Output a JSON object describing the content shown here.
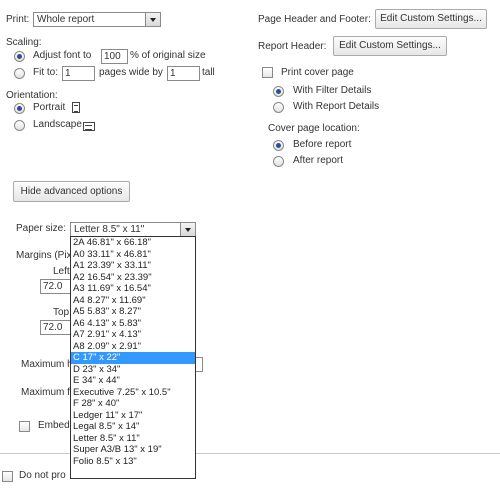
{
  "print": {
    "label": "Print:",
    "value": "Whole report"
  },
  "header_footer": {
    "label": "Page Header and Footer:",
    "button": "Edit Custom Settings..."
  },
  "report_header": {
    "label": "Report Header:",
    "button": "Edit Custom Settings..."
  },
  "scaling": {
    "label": "Scaling:",
    "adjust_label": "Adjust font to",
    "adjust_value": "100",
    "adjust_suffix": "% of original size",
    "fit_label": "Fit to:",
    "fit_wide": "1",
    "fit_mid": "pages wide by",
    "fit_tall": "1",
    "fit_suffix": "tall"
  },
  "cover": {
    "print_label": "Print cover page",
    "with_filter": "With Filter Details",
    "with_report": "With Report Details",
    "location_label": "Cover page location:",
    "before": "Before report",
    "after": "After report"
  },
  "orientation": {
    "label": "Orientation:",
    "portrait": "Portrait",
    "landscape": "Landscape"
  },
  "advanced_button": "Hide advanced options",
  "paper": {
    "label": "Paper size:",
    "value": "Letter 8.5\" x 11\"",
    "options": [
      "2A 46.81\" x 66.18\"",
      "A0 33.11\" x 46.81\"",
      "A1 23.39\" x 33.11\"",
      "A2 16.54\" x 23.39\"",
      "A3 11.69\" x 16.54\"",
      "A4 8.27\" x 11.69\"",
      "A5 5.83\" x 8.27\"",
      "A6 4.13\" x 5.83\"",
      "A7 2.91\" x 4.13\"",
      "A8 2.09\" x 2.91\"",
      "C 17\" x 22\"",
      "D 23\" x 34\"",
      "E 34\" x 44\"",
      "Executive 7.25\" x 10.5\"",
      "F 28\" x 40\"",
      "Ledger 11\" x 17\"",
      "Legal 8.5\" x 14\"",
      "Letter 8.5\" x 11\"",
      "Super A3/B 13\" x 19\"",
      "Folio 8.5\" x 13\""
    ],
    "selected": "C 17\" x 22\""
  },
  "margins": {
    "label": "Margins (Pix",
    "left_label": "Left",
    "left_value": "72.0",
    "top_label": "Top",
    "top_value": "72.0"
  },
  "maximum_h_label": "Maximum h",
  "maximum_f_label": "Maximum f",
  "embed_label": "Embed",
  "do_not_prompt_label": "Do not pro"
}
